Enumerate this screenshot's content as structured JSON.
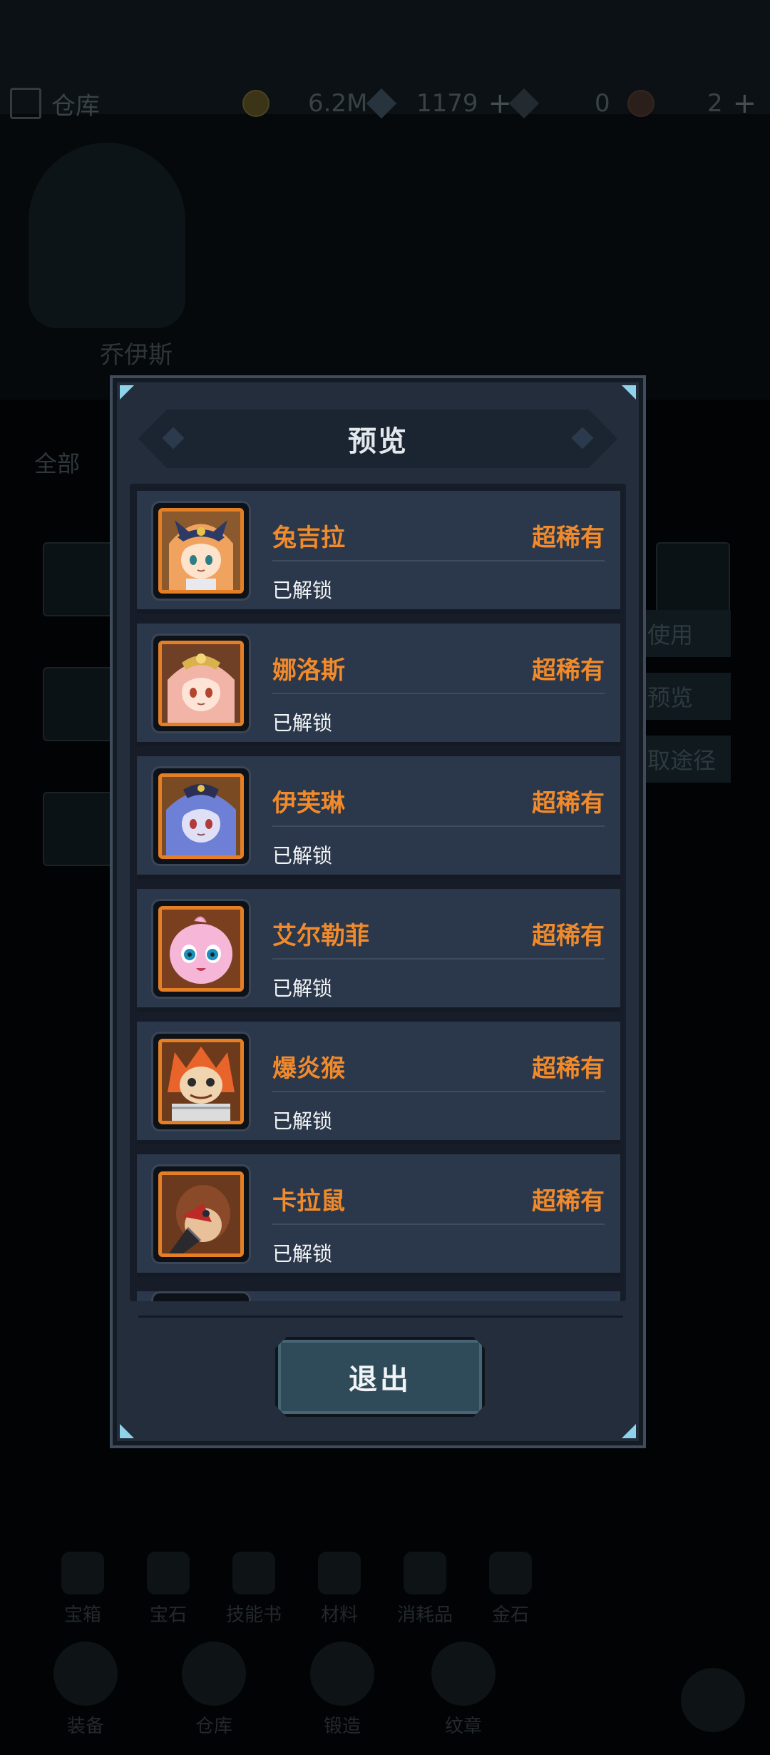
{
  "background": {
    "storage_title": "仓库",
    "gold": "6.2M",
    "diamond": "1179",
    "currency3": "0",
    "currency4": "2",
    "hero_name": "乔伊斯",
    "filter_label": "全部",
    "side_buttons": [
      "使用",
      "预览",
      "取途径"
    ],
    "categories": [
      "宝箱",
      "宝石",
      "技能书",
      "材料",
      "消耗品",
      "金石"
    ],
    "bottom_tabs": [
      "装备",
      "仓库",
      "锻造",
      "纹章"
    ]
  },
  "modal": {
    "title": "预览",
    "exit_label": "退出",
    "items": [
      {
        "name": "兔吉拉",
        "rarity": "超稀有",
        "status": "已解锁"
      },
      {
        "name": "娜洛斯",
        "rarity": "超稀有",
        "status": "已解锁"
      },
      {
        "name": "伊芙琳",
        "rarity": "超稀有",
        "status": "已解锁"
      },
      {
        "name": "艾尔勒菲",
        "rarity": "超稀有",
        "status": "已解锁"
      },
      {
        "name": "爆炎猴",
        "rarity": "超稀有",
        "status": "已解锁"
      },
      {
        "name": "卡拉鼠",
        "rarity": "超稀有",
        "status": "已解锁"
      }
    ]
  },
  "colors": {
    "accent_orange": "#f08a2b",
    "panel": "#232d3c",
    "row": "#2b374a",
    "button": "#2f4a58"
  }
}
